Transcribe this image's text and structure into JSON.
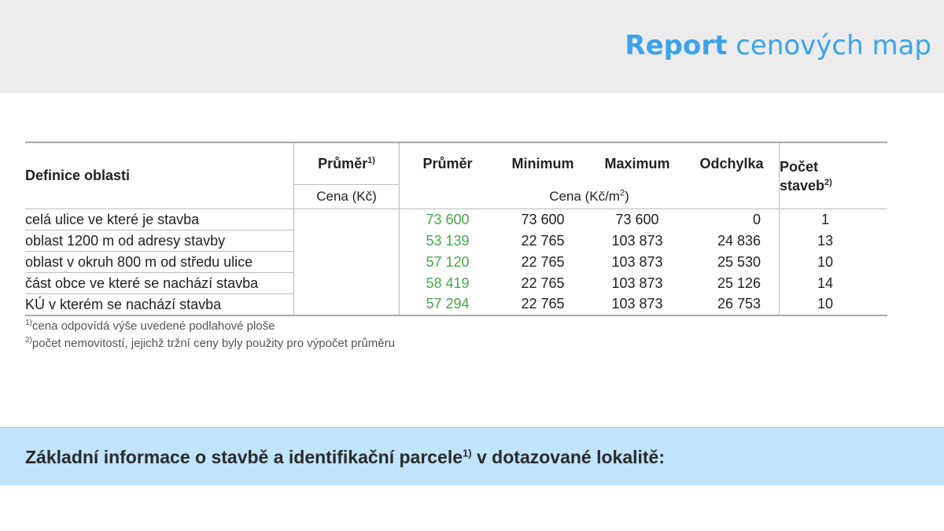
{
  "header": {
    "title_bold": "Report",
    "title_rest": "cenových map"
  },
  "table": {
    "col_definice": "Definice oblasti",
    "col_prumer1": "Průměr",
    "col_prumer1_sup": "1)",
    "col_prumer": "Průměr",
    "col_minimum": "Minimum",
    "col_maximum": "Maximum",
    "col_odchylka": "Odchylka",
    "col_pocet_line1": "Počet",
    "col_pocet_line2": "staveb",
    "col_pocet_sup": "2)",
    "unit_kc": "Cena (Kč)",
    "unit_kcm2": "Cena (Kč/m",
    "unit_kcm2_sup": "2",
    "unit_kcm2_close": ")",
    "rows": [
      {
        "label": "celá ulice ve které je stavba",
        "prumer": "73 600",
        "minimum": "73 600",
        "maximum": "73 600",
        "odchylka": "0",
        "pocet": "1"
      },
      {
        "label": "oblast 1200 m od adresy stavby",
        "prumer": "53 139",
        "minimum": "22 765",
        "maximum": "103 873",
        "odchylka": "24 836",
        "pocet": "13"
      },
      {
        "label": "oblast v okruh 800 m od středu ulice",
        "prumer": "57 120",
        "minimum": "22 765",
        "maximum": "103 873",
        "odchylka": "25 530",
        "pocet": "10"
      },
      {
        "label": "část obce ve které se nachází stavba",
        "prumer": "58 419",
        "minimum": "22 765",
        "maximum": "103 873",
        "odchylka": "25 126",
        "pocet": "14"
      },
      {
        "label": "KÚ v kterém se nachází stavba",
        "prumer": "57 294",
        "minimum": "22 765",
        "maximum": "103 873",
        "odchylka": "26 753",
        "pocet": "10"
      }
    ]
  },
  "footnotes": [
    {
      "mark": "1)",
      "text": "cena odpovídá výše uvedené podlahové ploše"
    },
    {
      "mark": "2)",
      "text": "počet nemovitostí, jejichž tržní ceny byly použity pro výpočet průměru"
    }
  ],
  "banner": {
    "text": "Základní informace o stavbě a identifikační parcele",
    "sup": "1)",
    "text_rest": " v dotazované lokalitě:"
  },
  "colors": {
    "accent": "#3ba3ec",
    "green_values": "#46a84a",
    "banner_bg": "#bfe4fb",
    "header_bg": "#ececec"
  }
}
